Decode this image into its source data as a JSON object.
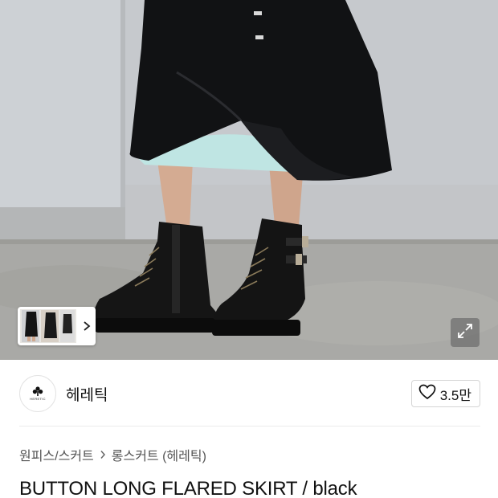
{
  "gallery": {
    "thumbnail_icon": "product-thumbnail-strip",
    "next_icon": "chevron-right-icon",
    "expand_icon": "expand-arrows-icon"
  },
  "brand": {
    "logo_text": "HERETIC",
    "name": "헤레틱",
    "like_icon": "heart-outline-icon",
    "like_count": "3.5만"
  },
  "breadcrumb": {
    "items": [
      "원피스/스커트",
      "롱스커트 (헤레틱)"
    ],
    "separator_icon": "chevron-right-icon"
  },
  "product": {
    "title": "BUTTON LONG FLARED SKIRT / black"
  },
  "colors": {
    "skirt": "#111214",
    "wall": "#c9ccd0",
    "floor": "#a9a9a6"
  }
}
